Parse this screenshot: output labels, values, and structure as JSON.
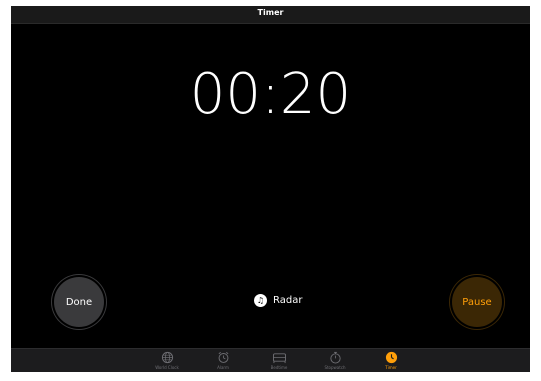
{
  "header": {
    "title": "Timer"
  },
  "timer": {
    "display": "00:20"
  },
  "controls": {
    "done_label": "Done",
    "pause_label": "Pause",
    "sound_label": "Radar",
    "sound_icon": "music-note-icon"
  },
  "tabs": [
    {
      "label": "World Clock",
      "icon": "globe-icon",
      "active": false
    },
    {
      "label": "Alarm",
      "icon": "alarm-clock-icon",
      "active": false
    },
    {
      "label": "Bedtime",
      "icon": "bed-icon",
      "active": false
    },
    {
      "label": "Stopwatch",
      "icon": "stopwatch-icon",
      "active": false
    },
    {
      "label": "Timer",
      "icon": "timer-icon",
      "active": true
    }
  ],
  "colors": {
    "accent": "#ff9f0a",
    "background": "#000000",
    "done_button": "#3a3a3c",
    "pause_button": "#3b2705",
    "tab_inactive": "#6e6e73"
  }
}
